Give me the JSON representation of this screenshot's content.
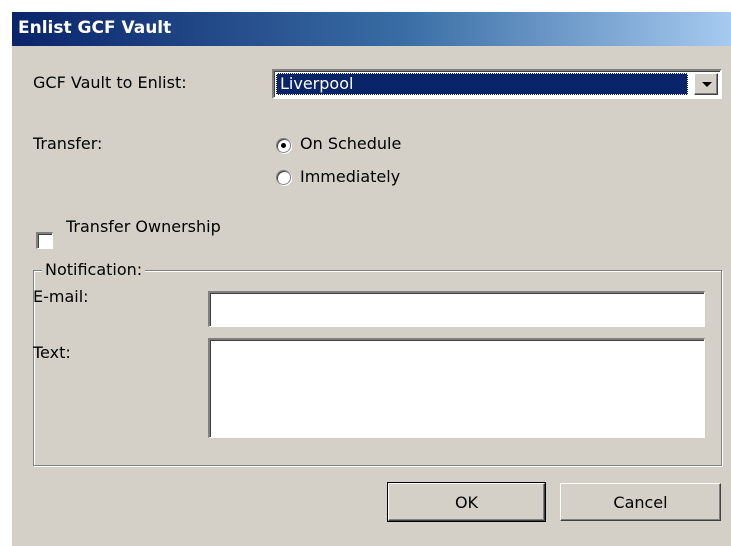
{
  "window": {
    "title": "Enlist GCF Vault"
  },
  "vault": {
    "label": "GCF Vault to Enlist:",
    "selected": "Liverpool"
  },
  "transfer": {
    "label": "Transfer:",
    "options": [
      {
        "label": "On Schedule",
        "checked": true
      },
      {
        "label": "Immediately",
        "checked": false
      }
    ]
  },
  "ownership": {
    "label": "Transfer Ownership",
    "checked": false
  },
  "notification": {
    "legend": "Notification:",
    "email_label": "E-mail:",
    "email_value": "",
    "text_label": "Text:",
    "text_value": ""
  },
  "buttons": {
    "ok": "OK",
    "cancel": "Cancel"
  }
}
